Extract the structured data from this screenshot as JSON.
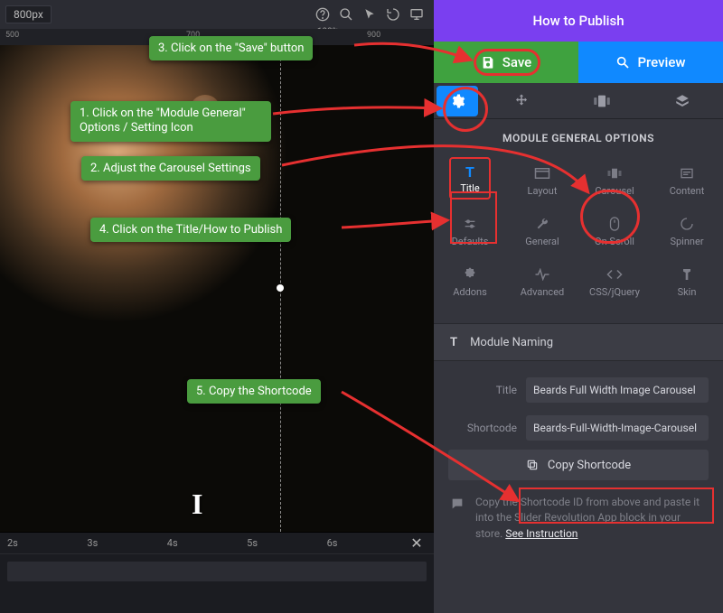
{
  "top": {
    "unit": "800px",
    "zoom_label": "100%",
    "ruler_ticks": [
      "500",
      "700",
      "900"
    ]
  },
  "timeline": {
    "marks": [
      "2s",
      "3s",
      "4s",
      "5s",
      "6s"
    ]
  },
  "header": {
    "title": "How to Publish"
  },
  "actions": {
    "save": "Save",
    "preview": "Preview"
  },
  "panel": {
    "heading": "MODULE GENERAL OPTIONS",
    "options": [
      {
        "id": "title",
        "label": "Title",
        "icon": "T"
      },
      {
        "id": "layout",
        "label": "Layout",
        "icon": "layout"
      },
      {
        "id": "carousel",
        "label": "Carousel",
        "icon": "carousel"
      },
      {
        "id": "content",
        "label": "Content",
        "icon": "content"
      },
      {
        "id": "defaults",
        "label": "Defaults",
        "icon": "sliders"
      },
      {
        "id": "general",
        "label": "General",
        "icon": "wrench"
      },
      {
        "id": "onscroll",
        "label": "On Scroll",
        "icon": "mouse"
      },
      {
        "id": "spinner",
        "label": "Spinner",
        "icon": "spinner"
      },
      {
        "id": "addons",
        "label": "Addons",
        "icon": "puzzle"
      },
      {
        "id": "advanced",
        "label": "Advanced",
        "icon": "pulse"
      },
      {
        "id": "cssjquery",
        "label": "CSS/jQuery",
        "icon": "code"
      },
      {
        "id": "skin",
        "label": "Skin",
        "icon": "skin"
      }
    ],
    "section": "Module Naming",
    "fields": {
      "title_label": "Title",
      "title_value": "Beards Full Width Image Carousel",
      "shortcode_label": "Shortcode",
      "shortcode_value": "Beards-Full-Width-Image-Carousel"
    },
    "copy_btn": "Copy Shortcode",
    "info_text": "Copy the Shortcode ID from above and paste it into the Slider Revolution App block in your store. ",
    "info_link": "See Instruction"
  },
  "annotations": {
    "a1": "1. Click on the \"Module General\" Options / Setting Icon",
    "a2": "2. Adjust the Carousel Settings",
    "a3": "3. Click on the \"Save\" button",
    "a4": "4. Click on the Title/How to Publish",
    "a5": "5. Copy the Shortcode"
  }
}
